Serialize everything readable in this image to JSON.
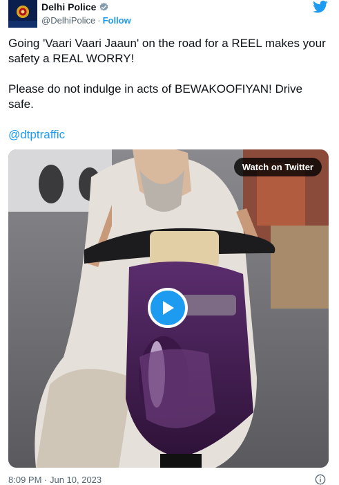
{
  "author": {
    "display_name": "Delhi Police",
    "handle": "@DelhiPolice",
    "separator": "·",
    "follow_label": "Follow"
  },
  "tweet": {
    "paragraph_1": "Going 'Vaari Vaari Jaaun' on the road for a REEL makes your safety a REAL WORRY!",
    "paragraph_2": "Please do not indulge in acts of BEWAKOOFIYAN! Drive safe.",
    "mention": "@dtptraffic"
  },
  "media": {
    "watch_label": "Watch on Twitter",
    "play_icon": "play-icon"
  },
  "footer": {
    "timestamp": "8:09 PM · Jun 10, 2023"
  },
  "icons": {
    "verified": "verified-badge-icon",
    "brand": "twitter-bird-icon",
    "info": "info-icon"
  },
  "colors": {
    "accent": "#1d9bf0",
    "text": "#0f1419",
    "muted": "#536471"
  }
}
